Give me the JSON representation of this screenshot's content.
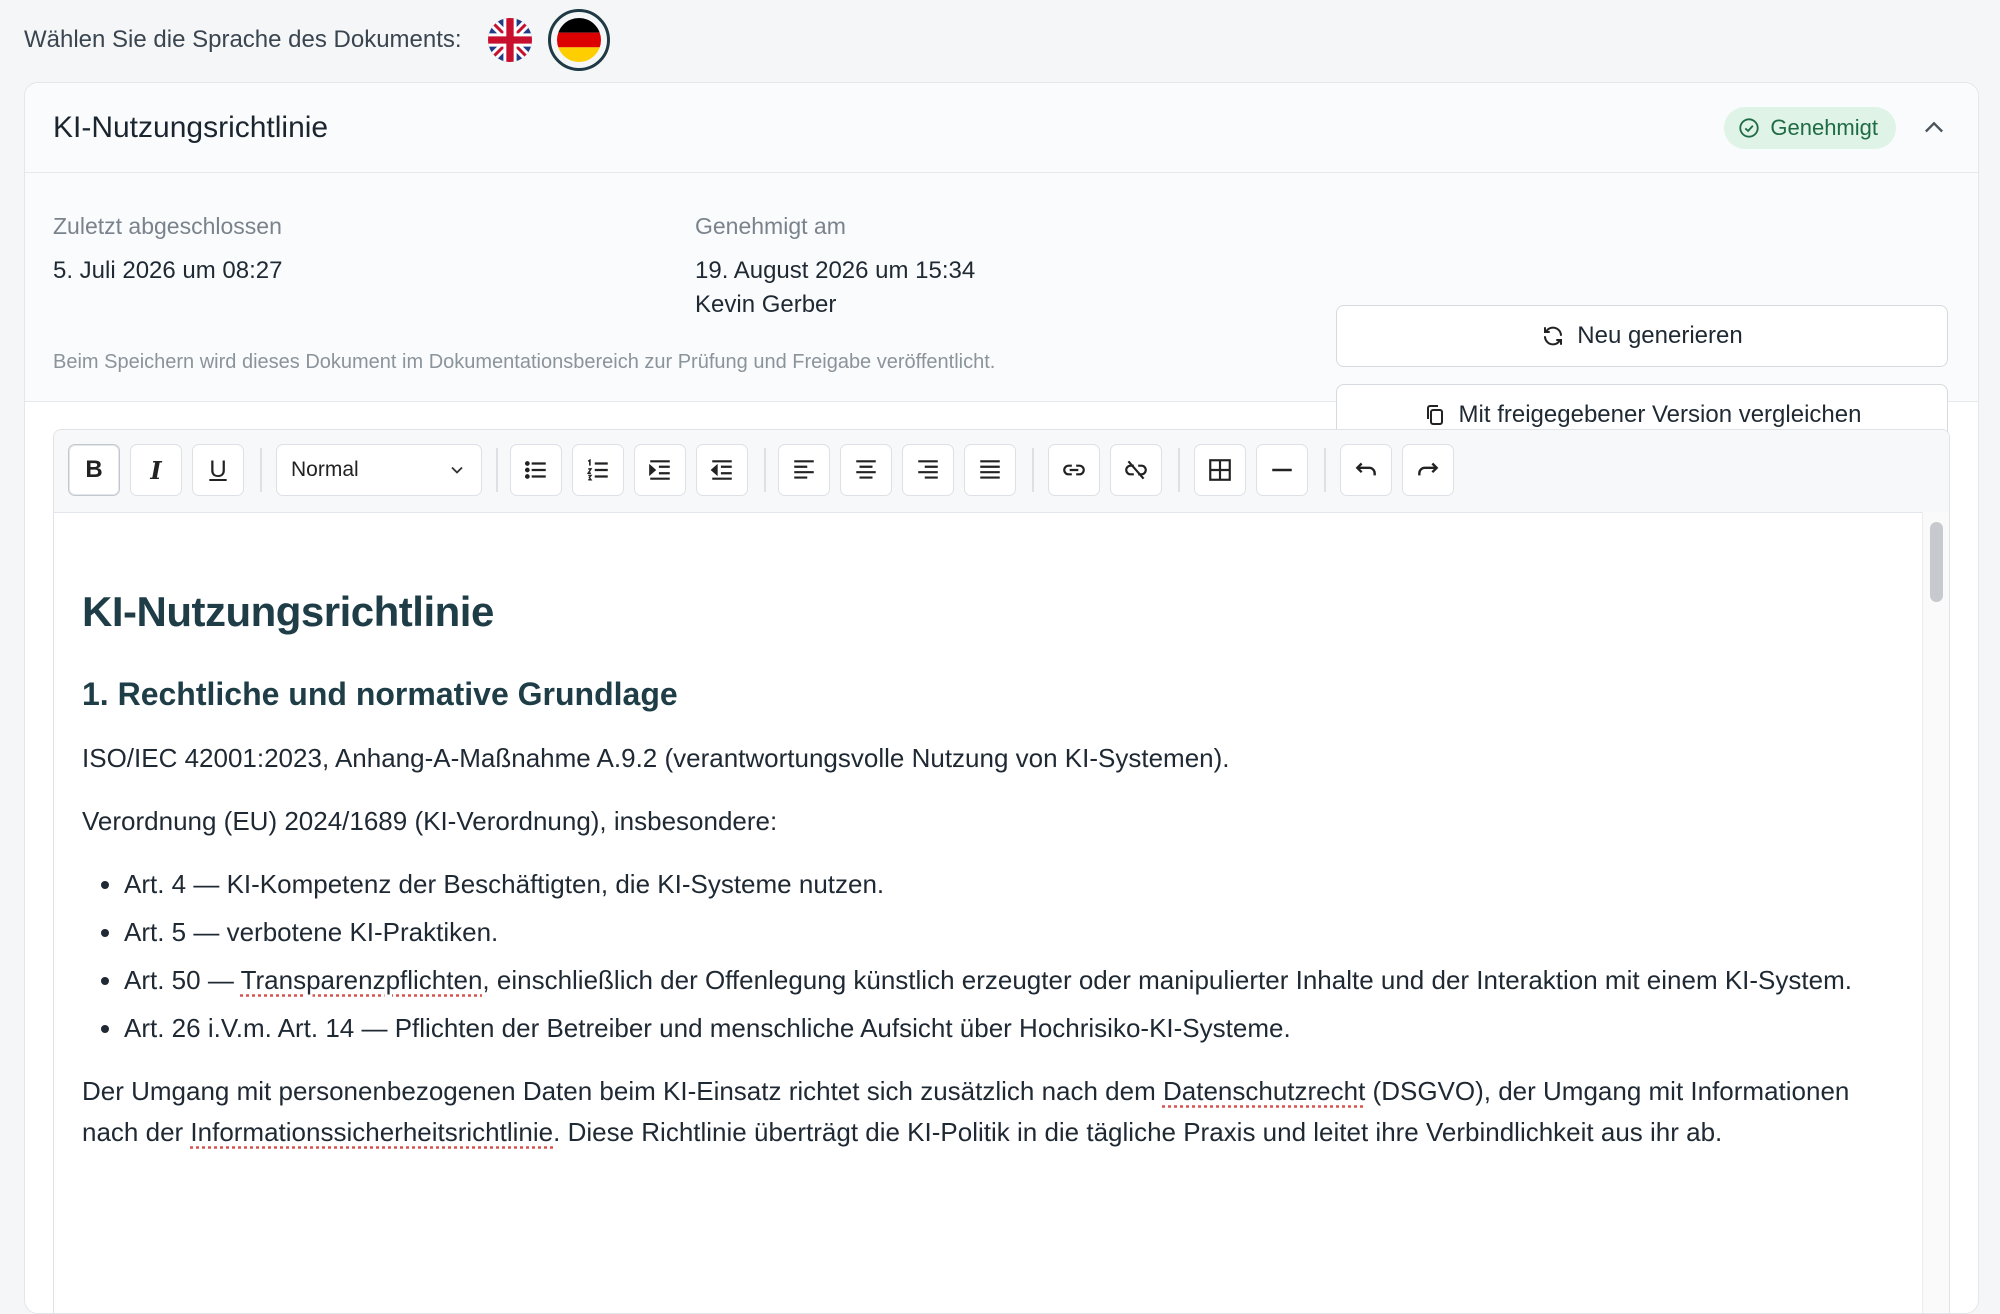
{
  "language": {
    "label": "Wählen Sie die Sprache des Dokuments:",
    "options": [
      {
        "name": "English",
        "icon": "uk-flag-icon",
        "selected": false
      },
      {
        "name": "Deutsch",
        "icon": "germany-flag-icon",
        "selected": true
      }
    ]
  },
  "card": {
    "title": "KI-Nutzungsrichtlinie",
    "status_badge": "Genehmigt",
    "status_color": "#1f6b45",
    "badge_bg": "#dff3e7"
  },
  "meta": {
    "last_completed_label": "Zuletzt abgeschlossen",
    "last_completed_value": "5. Juli 2026 um 08:27",
    "approved_label": "Genehmigt am",
    "approved_value": "19. August 2026 um 15:34",
    "approved_by": "Kevin Gerber",
    "note": "Beim Speichern wird dieses Dokument im Dokumentationsbereich zur Prüfung und Freigabe veröffentlicht.",
    "regenerate_button": "Neu generieren",
    "compare_button": "Mit freigegebener Version vergleichen"
  },
  "toolbar": {
    "format_select": "Normal",
    "buttons": [
      "bold",
      "italic",
      "underline",
      "bullet-list",
      "numbered-list",
      "indent",
      "outdent",
      "align-left",
      "align-center",
      "align-right",
      "align-justify",
      "link",
      "unlink",
      "table",
      "horizontal-rule",
      "undo",
      "redo"
    ],
    "bold_glyph": "B",
    "italic_glyph": "I",
    "underline_glyph": "U"
  },
  "document": {
    "h1": "KI-Nutzungsrichtlinie",
    "h2": "1. Rechtliche und normative Grundlage",
    "p1": "ISO/IEC 42001:2023, Anhang-A-Maßnahme A.9.2 (verantwortungsvolle Nutzung von KI-Systemen).",
    "p2": "Verordnung (EU) 2024/1689 (KI-Verordnung), insbesondere:",
    "list": {
      "item1": "Art. 4 — KI-Kompetenz der Beschäftigten, die KI-Systeme nutzen.",
      "item2": "Art. 5 — verbotene KI-Praktiken.",
      "item3_pre": "Art. 50 — ",
      "item3_spell": "Transparenzpflichten",
      "item3_post": ", einschließlich der Offenlegung künstlich erzeugter oder manipulierter Inhalte und der Interaktion mit einem KI-System.",
      "item4": "Art. 26 i.V.m. Art. 14 — Pflichten der Betreiber und menschliche Aufsicht über Hochrisiko-KI-Systeme."
    },
    "p3_a": "Der Umgang mit personenbezogenen Daten beim KI-Einsatz richtet sich zusätzlich nach dem ",
    "p3_spell1": "Datenschutzrecht",
    "p3_b": " (DSGVO), der Umgang mit Informationen nach der ",
    "p3_spell2": "Informationssicherheitsrichtlinie",
    "p3_c": ". Diese Richtlinie überträgt die KI-Politik in die tägliche Praxis und leitet ihre Verbindlichkeit aus ihr ab."
  }
}
